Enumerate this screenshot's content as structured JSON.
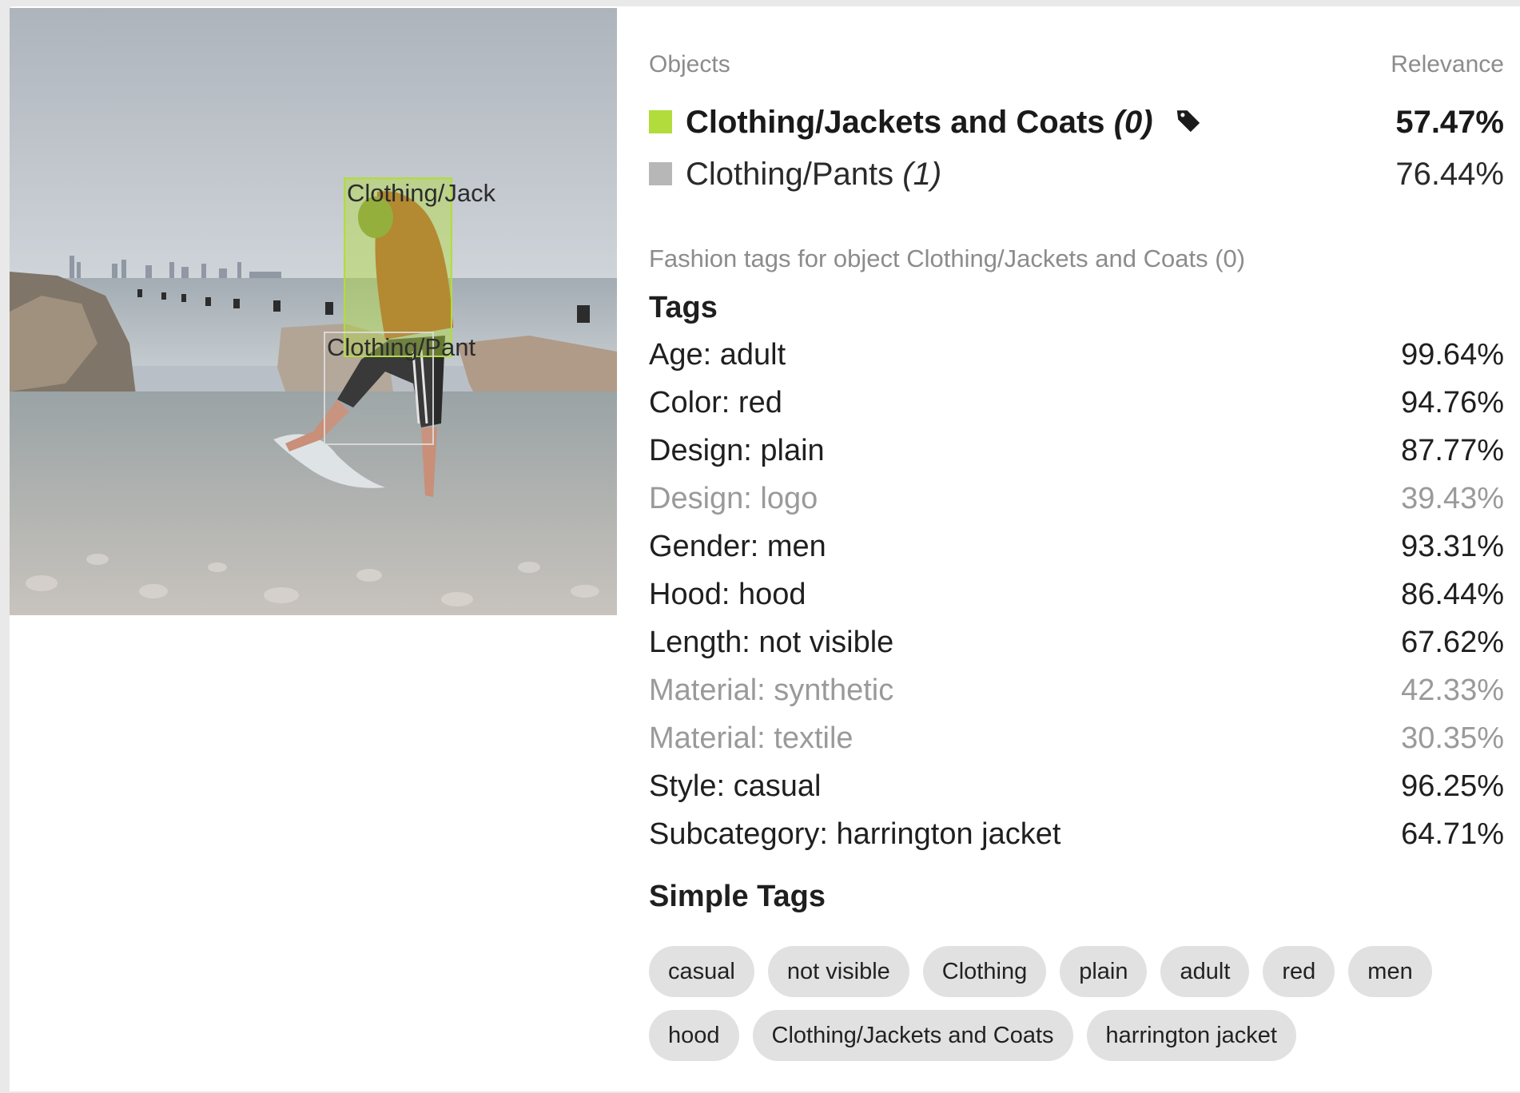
{
  "image": {
    "boxes": [
      {
        "label": "Clothing/Jack",
        "color": "#b2dc3c"
      },
      {
        "label": "Clothing/Pant",
        "color": "#d9d9d9"
      }
    ]
  },
  "objects_panel": {
    "objects_header": "Objects",
    "relevance_header": "Relevance",
    "objects": [
      {
        "name": "Clothing/Jackets and Coats",
        "index": "(0)",
        "relevance": "57.47%",
        "color": "#b2dc3c",
        "active": true,
        "icon": "tag-icon"
      },
      {
        "name": "Clothing/Pants",
        "index": "(1)",
        "relevance": "76.44%",
        "color": "#b7b7b7",
        "active": false
      }
    ]
  },
  "fashion": {
    "subtitle": "Fashion tags for object Clothing/Jackets and Coats (0)",
    "tags_title": "Tags",
    "tags": [
      {
        "label": "Age: adult",
        "value": "99.64%",
        "low": false
      },
      {
        "label": "Color: red",
        "value": "94.76%",
        "low": false
      },
      {
        "label": "Design: plain",
        "value": "87.77%",
        "low": false
      },
      {
        "label": "Design: logo",
        "value": "39.43%",
        "low": true
      },
      {
        "label": "Gender: men",
        "value": "93.31%",
        "low": false
      },
      {
        "label": "Hood: hood",
        "value": "86.44%",
        "low": false
      },
      {
        "label": "Length: not visible",
        "value": "67.62%",
        "low": false
      },
      {
        "label": "Material: synthetic",
        "value": "42.33%",
        "low": true
      },
      {
        "label": "Material: textile",
        "value": "30.35%",
        "low": true
      },
      {
        "label": "Style: casual",
        "value": "96.25%",
        "low": false
      },
      {
        "label": "Subcategory: harrington jacket",
        "value": "64.71%",
        "low": false
      }
    ],
    "simple_tags_title": "Simple Tags",
    "simple_tags": [
      [
        "casual",
        "not visible",
        "Clothing",
        "plain",
        "adult",
        "red",
        "men"
      ],
      [
        "hood",
        "Clothing/Jackets and Coats",
        "harrington jacket"
      ]
    ]
  },
  "colors": {
    "accent": "#b2dc3c",
    "muted_text": "#8c8c8c",
    "low_confidence_text": "#9a9a9a",
    "chip_bg": "#e1e1e1"
  }
}
